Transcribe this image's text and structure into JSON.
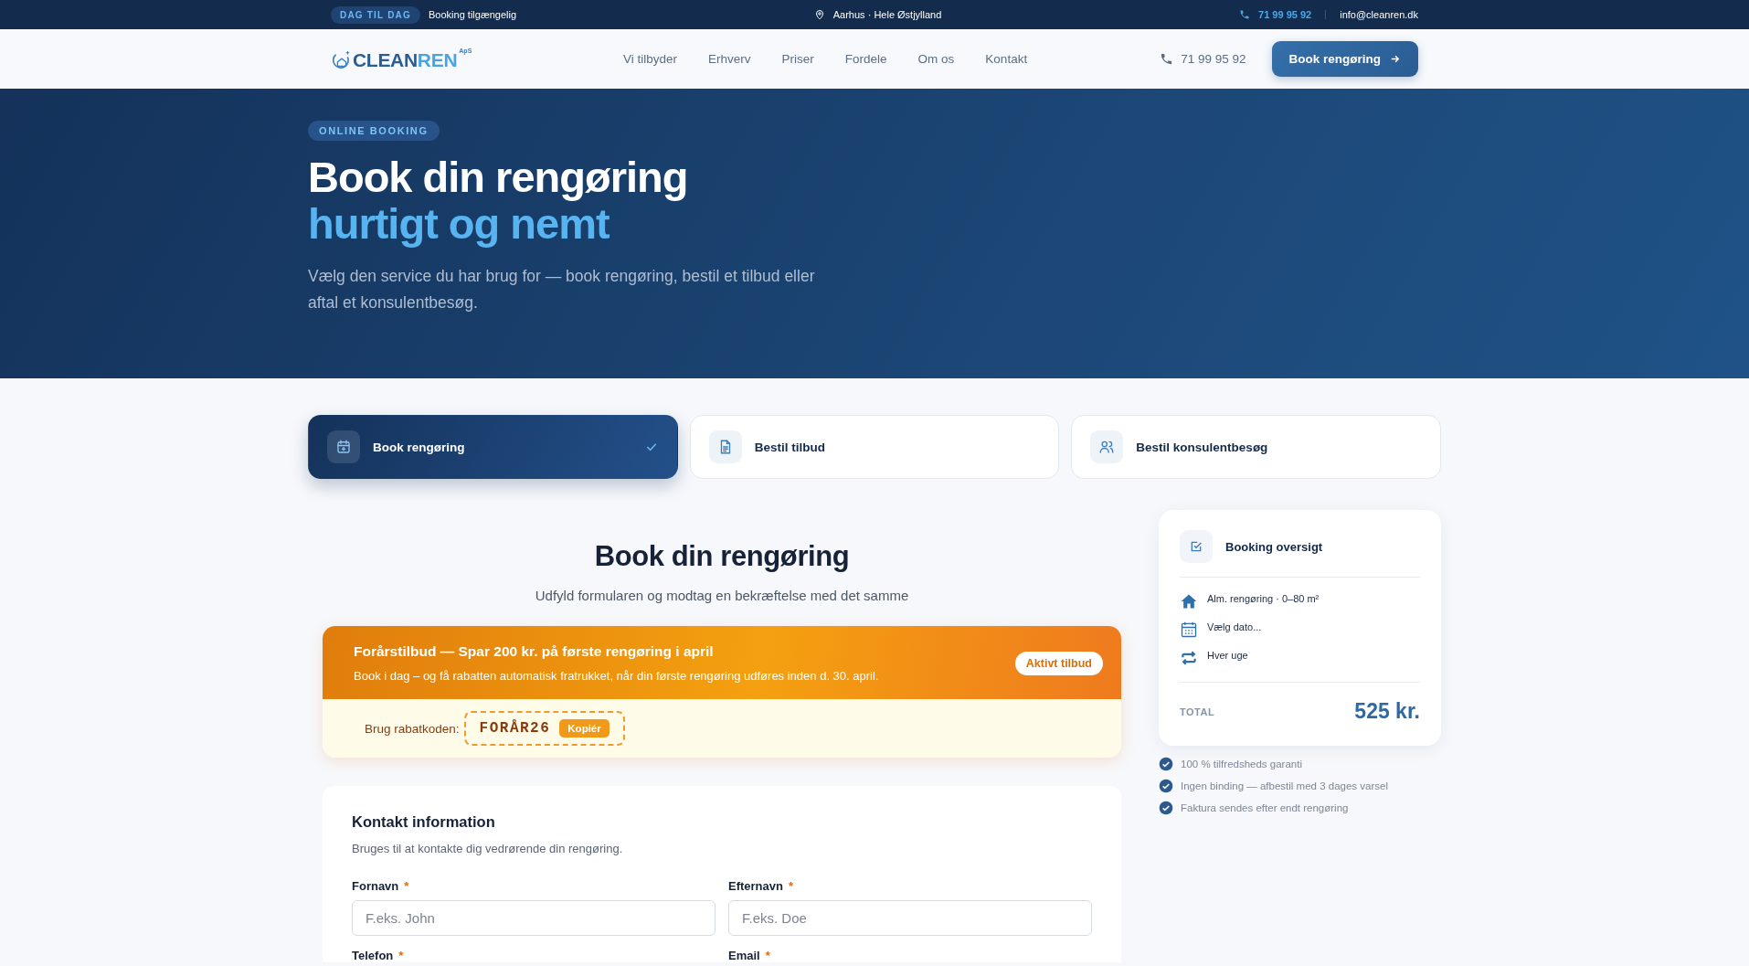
{
  "topbar": {
    "badge": "DAG TIL DAG",
    "availability": "Booking tilgængelig",
    "location": "Aarhus · Hele Østjylland",
    "phone": "71 99 95 92",
    "email": "info@cleanren.dk"
  },
  "nav": {
    "logo": {
      "part1": "CLEAN",
      "part2": "REN",
      "suffix": "ApS"
    },
    "links": [
      "Vi tilbyder",
      "Erhverv",
      "Priser",
      "Fordele",
      "Om os",
      "Kontakt"
    ],
    "phone": "71 99 95 92",
    "cta": "Book rengøring"
  },
  "hero": {
    "badge": "ONLINE BOOKING",
    "title_line1": "Book din rengøring",
    "title_line2": "hurtigt og nemt",
    "subtitle": "Vælg den service du har brug for — book rengøring, bestil et tilbud eller aftal et konsulentbesøg."
  },
  "booking_tabs": [
    {
      "kind": "calendar",
      "label": "Book rengøring",
      "selected": true
    },
    {
      "kind": "document",
      "label": "Bestil tilbud",
      "selected": false
    },
    {
      "kind": "people",
      "label": "Bestil konsulentbesøg",
      "selected": false
    }
  ],
  "form_header": {
    "title": "Book din rengøring",
    "subtitle": "Udfyld formularen og modtag en bekræftelse med det samme"
  },
  "promo": {
    "title": "Forårstilbud — Spar 200 kr. på første rengøring i april",
    "text": "Book i dag – og få rabatten automatisk fratrukket, når din første rengøring udføres inden d. 30. april.",
    "badge": "Aktivt tilbud",
    "code_label": "Brug rabatkoden:",
    "code": "FORÅR26",
    "copy_button": "Kopiér"
  },
  "contact_section": {
    "title": "Kontakt information",
    "subtitle": "Bruges til at kontakte dig vedrørende din rengøring.",
    "required_mark": "*",
    "fields": [
      {
        "label": "Fornavn",
        "required": true,
        "placeholder": "F.eks. John"
      },
      {
        "label": "Efternavn",
        "required": true,
        "placeholder": "F.eks. Doe"
      },
      {
        "label": "Telefon",
        "required": true
      },
      {
        "label": "Email",
        "required": true
      }
    ]
  },
  "summary": {
    "title": "Booking oversigt",
    "items": [
      {
        "kind": "service",
        "text": "Alm. rengøring · 0–80 m²"
      },
      {
        "kind": "date",
        "text": "Vælg dato..."
      },
      {
        "kind": "frequency",
        "text": "Hver uge"
      }
    ],
    "total_label": "TOTAL",
    "total": "525 kr."
  },
  "guarantees": [
    "100 % tilfredsheds garanti",
    "Ingen binding — afbestil med 3 dages varsel",
    "Faktura sendes efter endt rengøring"
  ]
}
